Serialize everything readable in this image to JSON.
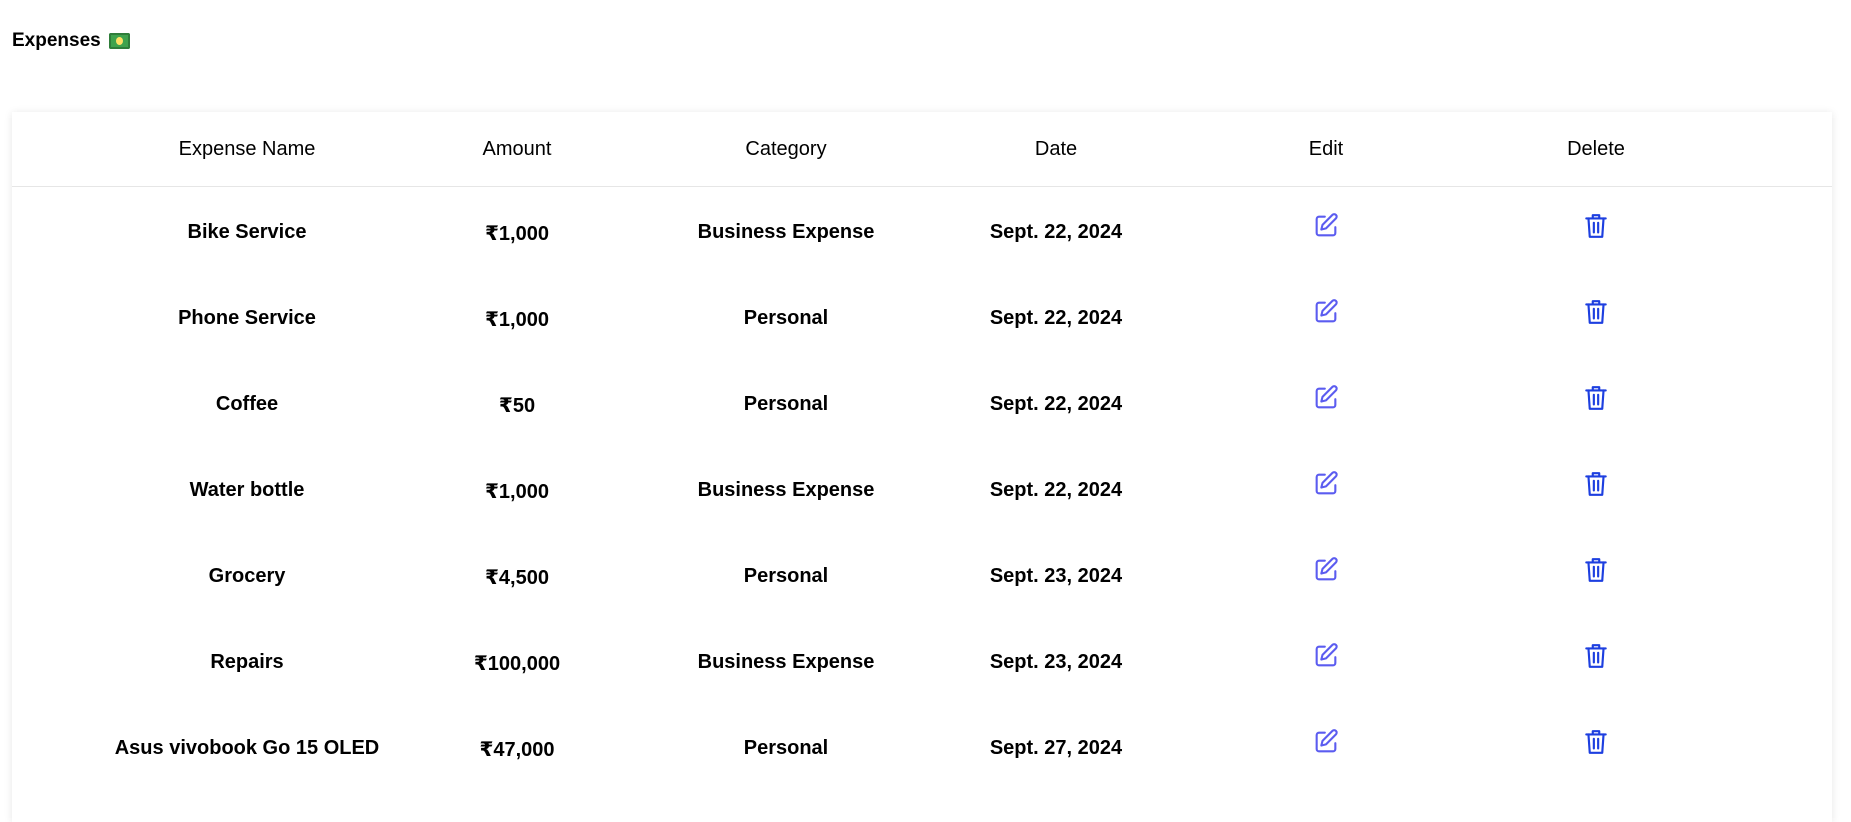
{
  "page": {
    "title": "Expenses",
    "title_icon": "money-bill-icon"
  },
  "table": {
    "headers": [
      "Expense Name",
      "Amount",
      "Category",
      "Date",
      "Edit",
      "Delete"
    ],
    "rows": [
      {
        "name": "Bike Service",
        "amount": "₹1,000",
        "category": "Business Expense",
        "date": "Sept. 22, 2024"
      },
      {
        "name": "Phone Service",
        "amount": "₹1,000",
        "category": "Personal",
        "date": "Sept. 22, 2024"
      },
      {
        "name": "Coffee",
        "amount": "₹50",
        "category": "Personal",
        "date": "Sept. 22, 2024"
      },
      {
        "name": "Water bottle",
        "amount": "₹1,000",
        "category": "Business Expense",
        "date": "Sept. 22, 2024"
      },
      {
        "name": "Grocery",
        "amount": "₹4,500",
        "category": "Personal",
        "date": "Sept. 23, 2024"
      },
      {
        "name": "Repairs",
        "amount": "₹100,000",
        "category": "Business Expense",
        "date": "Sept. 23, 2024"
      },
      {
        "name": "Asus vivobook Go 15 OLED",
        "amount": "₹47,000",
        "category": "Personal",
        "date": "Sept. 27, 2024"
      }
    ]
  },
  "icons": {
    "edit": "edit-icon",
    "delete": "trash-icon"
  },
  "colors": {
    "edit_icon": "#5b5cf0",
    "delete_icon": "#1d3fe0",
    "header_divider": "#e6e6e6"
  }
}
